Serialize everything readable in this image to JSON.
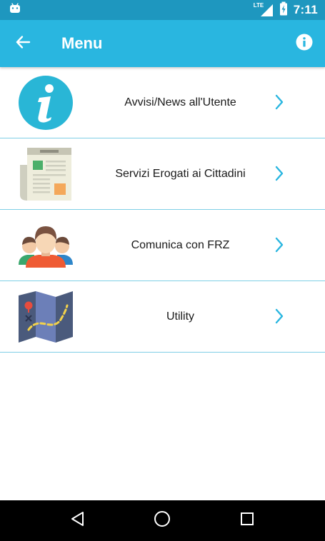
{
  "status_bar": {
    "time": "7:11",
    "network_label": "LTE",
    "icons": [
      "android-icon",
      "signal-icon",
      "battery-charging-icon"
    ]
  },
  "app_bar": {
    "title": "Menu",
    "back_icon": "arrow-back-icon",
    "info_icon": "info-icon",
    "color": "#29b6e0"
  },
  "menu": {
    "items": [
      {
        "label": "Avvisi/News all'Utente",
        "icon": "info-circle-icon"
      },
      {
        "label": "Servizi Erogati ai Cittadini",
        "icon": "newspaper-icon"
      },
      {
        "label": "Comunica con FRZ",
        "icon": "people-group-icon"
      },
      {
        "label": "Utility",
        "icon": "treasure-map-icon"
      }
    ],
    "chevron_color": "#29b6e0",
    "divider_color": "#7fcfe6"
  },
  "nav_bar": {
    "buttons": [
      "back-triangle-icon",
      "home-circle-icon",
      "recents-square-icon"
    ]
  }
}
